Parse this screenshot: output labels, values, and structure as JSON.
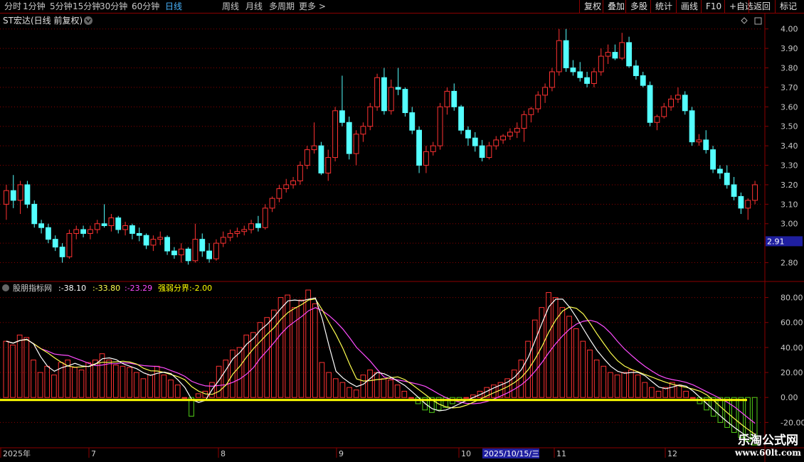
{
  "toolbar": {
    "periods": [
      "分时",
      "1分钟",
      "5分钟",
      "15分钟",
      "30分钟",
      "60分钟",
      "日线",
      "周线",
      "月线",
      "多周期",
      "更多 >"
    ],
    "active_period": "日线",
    "right_buttons": [
      "复权",
      "叠加",
      "多股",
      "统计",
      "画线",
      "F10",
      "+自选",
      "返回"
    ],
    "mark_label": "标记"
  },
  "main_panel": {
    "title": "ST宏达(日线 前复权)",
    "price_axis": [
      "4.00",
      "3.90",
      "3.80",
      "3.70",
      "3.60",
      "3.50",
      "3.40",
      "3.30",
      "3.20",
      "3.10",
      "3.00",
      "2.90",
      "2.80"
    ],
    "current_price_label": "2.91"
  },
  "indicator_panel": {
    "title": "股朋指标网",
    "values": [
      ":-38.10",
      ":-33.80",
      ":-23.29"
    ],
    "threshold_label": "强弱分界:-2.00",
    "axis": [
      "80.00",
      "60.00",
      "40.00",
      "20.00",
      "0.00",
      "-20.00"
    ]
  },
  "date_axis": {
    "labels": [
      "2025年",
      "7",
      "8",
      "9",
      "10",
      "2025/10/15/三",
      "11",
      "12"
    ]
  },
  "watermark": {
    "title": "乐淘公式网",
    "url": "www.60lt.com"
  },
  "colors": {
    "up": "#ff3232",
    "down": "#54ffff",
    "positive_bar": "#ff3232",
    "negative_bar": "#52d017",
    "line_white": "#ffffff",
    "line_yellow": "#ffff4f",
    "line_magenta": "#ff4cff",
    "threshold": "#ffff00",
    "grid": "#8b0000",
    "axis_text": "#c8c8c8"
  },
  "chart_data": [
    {
      "type": "candlestick",
      "title": "ST宏达(日线 前复权)",
      "ylim": [
        2.74,
        4.05
      ],
      "x_labels": [
        "2025年",
        "7",
        "8",
        "9",
        "10",
        "11",
        "12"
      ],
      "ohlc": [
        [
          3.1,
          3.2,
          3.02,
          3.17
        ],
        [
          3.17,
          3.25,
          3.08,
          3.12
        ],
        [
          3.12,
          3.22,
          3.05,
          3.2
        ],
        [
          3.2,
          3.22,
          3.08,
          3.1
        ],
        [
          3.1,
          3.12,
          2.98,
          3.0
        ],
        [
          3.0,
          3.02,
          2.95,
          2.98
        ],
        [
          2.98,
          3.0,
          2.9,
          2.92
        ],
        [
          2.92,
          2.94,
          2.86,
          2.88
        ],
        [
          2.88,
          2.9,
          2.8,
          2.83
        ],
        [
          2.83,
          2.97,
          2.82,
          2.95
        ],
        [
          2.95,
          2.99,
          2.92,
          2.97
        ],
        [
          2.97,
          2.99,
          2.93,
          2.95
        ],
        [
          2.95,
          2.99,
          2.92,
          2.97
        ],
        [
          2.97,
          3.02,
          2.95,
          3.0
        ],
        [
          3.0,
          3.1,
          2.98,
          2.99
        ],
        [
          2.99,
          3.05,
          2.96,
          3.03
        ],
        [
          3.03,
          3.04,
          2.95,
          2.97
        ],
        [
          2.97,
          3.01,
          2.94,
          2.99
        ],
        [
          2.99,
          3.0,
          2.92,
          2.95
        ],
        [
          2.95,
          2.98,
          2.91,
          2.94
        ],
        [
          2.94,
          2.95,
          2.87,
          2.89
        ],
        [
          2.89,
          2.94,
          2.86,
          2.92
        ],
        [
          2.92,
          2.96,
          2.89,
          2.93
        ],
        [
          2.93,
          2.94,
          2.84,
          2.86
        ],
        [
          2.86,
          2.88,
          2.82,
          2.84
        ],
        [
          2.84,
          2.9,
          2.8,
          2.87
        ],
        [
          2.87,
          2.88,
          2.79,
          2.81
        ],
        [
          2.81,
          3.0,
          2.8,
          2.92
        ],
        [
          2.92,
          2.95,
          2.83,
          2.86
        ],
        [
          2.86,
          2.9,
          2.8,
          2.82
        ],
        [
          2.82,
          2.92,
          2.81,
          2.9
        ],
        [
          2.9,
          2.96,
          2.88,
          2.93
        ],
        [
          2.93,
          2.97,
          2.91,
          2.95
        ],
        [
          2.95,
          2.98,
          2.93,
          2.96
        ],
        [
          2.96,
          2.99,
          2.94,
          2.97
        ],
        [
          2.97,
          3.02,
          2.95,
          3.0
        ],
        [
          3.0,
          3.04,
          2.96,
          2.98
        ],
        [
          2.98,
          3.1,
          2.97,
          3.08
        ],
        [
          3.08,
          3.14,
          3.06,
          3.13
        ],
        [
          3.13,
          3.2,
          3.11,
          3.18
        ],
        [
          3.18,
          3.23,
          3.16,
          3.2
        ],
        [
          3.2,
          3.24,
          3.18,
          3.22
        ],
        [
          3.22,
          3.32,
          3.2,
          3.3
        ],
        [
          3.3,
          3.4,
          3.28,
          3.38
        ],
        [
          3.38,
          3.52,
          3.36,
          3.4
        ],
        [
          3.4,
          3.42,
          3.25,
          3.26
        ],
        [
          3.26,
          3.38,
          3.22,
          3.34
        ],
        [
          3.34,
          3.6,
          3.32,
          3.58
        ],
        [
          3.58,
          3.76,
          3.5,
          3.52
        ],
        [
          3.52,
          3.55,
          3.33,
          3.36
        ],
        [
          3.36,
          3.48,
          3.3,
          3.46
        ],
        [
          3.46,
          3.52,
          3.42,
          3.5
        ],
        [
          3.5,
          3.62,
          3.48,
          3.6
        ],
        [
          3.6,
          3.77,
          3.58,
          3.75
        ],
        [
          3.75,
          3.8,
          3.56,
          3.58
        ],
        [
          3.58,
          3.74,
          3.56,
          3.7
        ],
        [
          3.7,
          3.8,
          3.66,
          3.69
        ],
        [
          3.69,
          3.7,
          3.55,
          3.57
        ],
        [
          3.57,
          3.6,
          3.46,
          3.48
        ],
        [
          3.48,
          3.5,
          3.26,
          3.3
        ],
        [
          3.3,
          3.4,
          3.26,
          3.37
        ],
        [
          3.37,
          3.42,
          3.35,
          3.4
        ],
        [
          3.4,
          3.62,
          3.38,
          3.6
        ],
        [
          3.6,
          3.7,
          3.56,
          3.68
        ],
        [
          3.68,
          3.72,
          3.58,
          3.6
        ],
        [
          3.6,
          3.61,
          3.46,
          3.48
        ],
        [
          3.48,
          3.5,
          3.4,
          3.44
        ],
        [
          3.44,
          3.47,
          3.37,
          3.4
        ],
        [
          3.4,
          3.43,
          3.32,
          3.34
        ],
        [
          3.34,
          3.42,
          3.33,
          3.4
        ],
        [
          3.4,
          3.45,
          3.38,
          3.43
        ],
        [
          3.43,
          3.46,
          3.41,
          3.45
        ],
        [
          3.45,
          3.49,
          3.43,
          3.47
        ],
        [
          3.47,
          3.52,
          3.44,
          3.49
        ],
        [
          3.49,
          3.58,
          3.42,
          3.56
        ],
        [
          3.56,
          3.6,
          3.52,
          3.59
        ],
        [
          3.59,
          3.68,
          3.57,
          3.66
        ],
        [
          3.66,
          3.72,
          3.62,
          3.7
        ],
        [
          3.7,
          3.8,
          3.68,
          3.78
        ],
        [
          3.78,
          4.0,
          3.76,
          3.94
        ],
        [
          3.94,
          4.0,
          3.78,
          3.8
        ],
        [
          3.8,
          3.84,
          3.76,
          3.78
        ],
        [
          3.78,
          3.83,
          3.73,
          3.75
        ],
        [
          3.75,
          3.78,
          3.7,
          3.72
        ],
        [
          3.72,
          3.8,
          3.7,
          3.78
        ],
        [
          3.78,
          3.9,
          3.76,
          3.86
        ],
        [
          3.86,
          3.92,
          3.82,
          3.88
        ],
        [
          3.88,
          3.92,
          3.84,
          3.85
        ],
        [
          3.85,
          3.98,
          3.84,
          3.93
        ],
        [
          3.93,
          3.96,
          3.8,
          3.81
        ],
        [
          3.81,
          3.84,
          3.74,
          3.76
        ],
        [
          3.76,
          3.78,
          3.7,
          3.71
        ],
        [
          3.71,
          3.73,
          3.5,
          3.52
        ],
        [
          3.52,
          3.56,
          3.48,
          3.55
        ],
        [
          3.55,
          3.62,
          3.54,
          3.6
        ],
        [
          3.6,
          3.66,
          3.58,
          3.64
        ],
        [
          3.64,
          3.7,
          3.62,
          3.66
        ],
        [
          3.66,
          3.68,
          3.56,
          3.58
        ],
        [
          3.58,
          3.6,
          3.4,
          3.42
        ],
        [
          3.42,
          3.46,
          3.4,
          3.43
        ],
        [
          3.43,
          3.48,
          3.36,
          3.38
        ],
        [
          3.38,
          3.4,
          3.26,
          3.28
        ],
        [
          3.28,
          3.3,
          3.23,
          3.26
        ],
        [
          3.26,
          3.3,
          3.18,
          3.2
        ],
        [
          3.2,
          3.24,
          3.12,
          3.14
        ],
        [
          3.14,
          3.16,
          3.05,
          3.08
        ],
        [
          3.08,
          3.13,
          3.02,
          3.12
        ],
        [
          3.12,
          3.22,
          3.1,
          3.2
        ]
      ]
    },
    {
      "type": "bar",
      "title": "股朋指标网",
      "ylim": [
        -38,
        90
      ],
      "threshold": -2.0,
      "series": [
        {
          "name": "强弱分界",
          "values": [
            -2.0
          ]
        }
      ],
      "values": [
        45,
        42,
        50,
        48,
        30,
        20,
        25,
        18,
        28,
        30,
        24,
        22,
        28,
        30,
        35,
        30,
        26,
        25,
        24,
        20,
        15,
        18,
        25,
        18,
        14,
        10,
        0,
        -15,
        3,
        5,
        12,
        25,
        30,
        38,
        40,
        50,
        52,
        60,
        64,
        70,
        80,
        82,
        72,
        78,
        86,
        75,
        28,
        20,
        15,
        12,
        8,
        6,
        18,
        22,
        20,
        15,
        14,
        10,
        5,
        0,
        -5,
        -10,
        -12,
        -10,
        -8,
        -5,
        -2,
        0,
        2,
        5,
        8,
        10,
        12,
        15,
        22,
        30,
        45,
        62,
        72,
        84,
        80,
        72,
        65,
        55,
        45,
        38,
        30,
        25,
        20,
        18,
        20,
        22,
        18,
        12,
        8,
        5,
        8,
        12,
        10,
        5,
        0,
        -5,
        -10,
        -15,
        -20,
        -24,
        -28,
        -32,
        -35,
        -38
      ],
      "lines": {
        "white": [
          -4,
          -5,
          -6,
          -8,
          -10,
          -12,
          -14,
          -16,
          -18,
          -20
        ],
        "yellow": [
          -2,
          -3,
          -4,
          -5,
          -6,
          -7,
          -8,
          -9,
          -10,
          -11
        ],
        "magenta": [
          0,
          -1,
          -2,
          -3,
          -4,
          -5,
          -6,
          -7,
          -8,
          -9
        ]
      }
    }
  ]
}
